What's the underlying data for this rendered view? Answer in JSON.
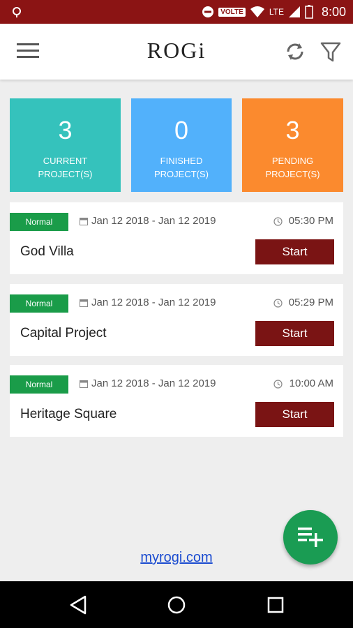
{
  "status_bar": {
    "volte": "VOLTE",
    "network": "LTE",
    "time": "8:00"
  },
  "app_bar": {
    "logo_text": "ROGi",
    "icons": [
      "menu-icon",
      "refresh-icon",
      "filter-icon"
    ]
  },
  "stats": [
    {
      "value": "3",
      "label_line1": "CURRENT",
      "label_line2": "PROJECT(S)",
      "color": "#35c2bc"
    },
    {
      "value": "0",
      "label_line1": "FINISHED",
      "label_line2": "PROJECT(S)",
      "color": "#52b1fb"
    },
    {
      "value": "3",
      "label_line1": "PENDING",
      "label_line2": "PROJECT(S)",
      "color": "#fb8a2e"
    }
  ],
  "projects": [
    {
      "priority": "Normal",
      "date_range": "Jan 12 2018 - Jan 12 2019",
      "time": "05:30 PM",
      "name": "God Villa",
      "action": "Start"
    },
    {
      "priority": "Normal",
      "date_range": "Jan 12 2018 - Jan 12 2019",
      "time": "05:29 PM",
      "name": "Capital Project",
      "action": "Start"
    },
    {
      "priority": "Normal",
      "date_range": "Jan 12 2018 - Jan 12 2019",
      "time": "10:00 AM",
      "name": "Heritage Square",
      "action": "Start"
    }
  ],
  "footer": {
    "link_text": "myrogi.com"
  },
  "colors": {
    "brand": "#8b1414",
    "badge_green": "#1a9c49",
    "start_button": "#7a1414",
    "fab": "#1a9c53"
  }
}
